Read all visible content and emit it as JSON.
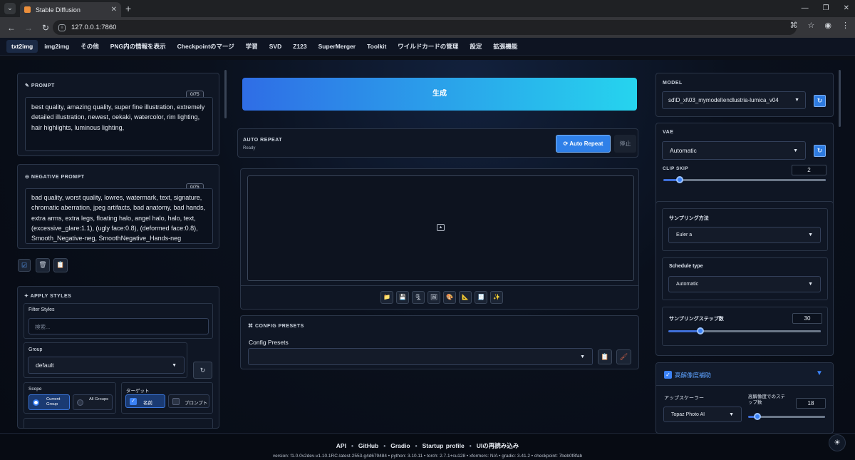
{
  "browser": {
    "tab_title": "Stable Diffusion",
    "tab_close": "✕",
    "new_tab": "+",
    "url": "127.0.0.1:7860",
    "win_controls": [
      "—",
      "❐",
      "✕"
    ]
  },
  "nav": {
    "tabs": [
      "txt2img",
      "img2img",
      "その他",
      "PNG内の情報を表示",
      "Checkpointのマージ",
      "学習",
      "SVD",
      "Z123",
      "SuperMerger",
      "Toolkit",
      "ワイルドカードの管理",
      "設定",
      "拡張機能"
    ],
    "active": "txt2img"
  },
  "prompt": {
    "label": "PROMPT",
    "counter": "0/75",
    "text": "best quality, amazing quality, super fine illustration, extremely detailed illustration, newest, oekaki, watercolor, rim lighting, hair highlights, luminous lighting,"
  },
  "negative": {
    "label": "NEGATIVE PROMPT",
    "counter": "0/75",
    "text": "bad quality, worst quality, lowres, watermark, text, signature, chromatic aberration, jpeg artifacts, bad anatomy, bad hands, extra arms, extra legs, floating halo, angel halo, halo, text, (excessive_glare:1.1), (ugly face:0.8), (deformed face:0.8), Smooth_Negative-neg, SmoothNegative_Hands-neg"
  },
  "styles": {
    "label": "APPLY STYLES",
    "filter_label": "Filter Styles",
    "filter_placeholder": "検索...",
    "group_label": "Group",
    "group_value": "default",
    "scope_label": "Scope",
    "scope_current": "Current Group",
    "scope_all": "All Groups",
    "target_label": "ターゲット",
    "target_name": "名前",
    "target_prompt": "プロンプト"
  },
  "generate": {
    "label": "生成",
    "gradient_from": "#2f6de6",
    "gradient_to": "#26d4ee"
  },
  "auto_repeat": {
    "label": "AUTO REPEAT",
    "status": "Ready",
    "button": "Auto Repeat",
    "stop": "停止"
  },
  "output_tools": [
    "📁",
    "💾",
    "🗜",
    "🖼",
    "🎨",
    "📐",
    "🧾",
    "✨"
  ],
  "config": {
    "label": "CONFIG PRESETS",
    "field_label": "Config Presets",
    "value": ""
  },
  "model": {
    "label": "MODEL",
    "value": "sd\\D_xl\\03_mymodel\\endlustria-lumica_v04"
  },
  "vae": {
    "label": "VAE",
    "value": "Automatic"
  },
  "clip_skip": {
    "label": "CLIP SKIP",
    "value": "2",
    "fraction": 0.1
  },
  "sampler": {
    "label": "サンプリング方法",
    "value": "Euler a"
  },
  "schedule": {
    "label": "Schedule type",
    "value": "Automatic"
  },
  "steps": {
    "label": "サンプリングステップ数",
    "value": "30",
    "fraction": 0.21
  },
  "hires": {
    "label": "高解像度補助",
    "upscaler_label": "アップスケーラー",
    "upscaler_value": "Topaz Photo AI",
    "steps_label": "高解像度でのステップ数",
    "steps_value": "18",
    "steps_fraction": 0.12
  },
  "footer": {
    "links": [
      "API",
      "GitHub",
      "Gradio",
      "Startup profile",
      "UIの再読み込み"
    ],
    "version": "version: f1.0.0v2dev-v1.10.1RC-latest-2553-g4d679484  •  python: 3.10.11  •  torch: 2.7.1+cu128  •  xformers: N/A  •  gradio: 3.41.2  •  checkpoint: 7beb0f8fab"
  }
}
